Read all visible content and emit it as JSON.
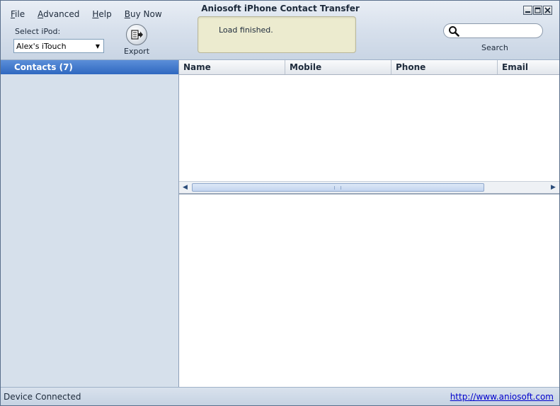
{
  "window": {
    "title": "Aniosoft iPhone Contact Transfer"
  },
  "menu": [
    {
      "label": "File",
      "underline": "F",
      "rest": "ile"
    },
    {
      "label": "Advanced",
      "underline": "A",
      "rest": "dvanced"
    },
    {
      "label": "Help",
      "underline": "H",
      "rest": "elp"
    },
    {
      "label": "Buy Now",
      "underline": "B",
      "rest": "uy Now"
    }
  ],
  "device_select": {
    "label": "Select iPod:",
    "value": "Alex's iTouch"
  },
  "toolbar": {
    "export_label": "Export"
  },
  "status_panel": {
    "message": "Load finished."
  },
  "search": {
    "label": "Search",
    "value": ""
  },
  "sidebar": {
    "header": "Contacts (7)"
  },
  "table": {
    "columns": [
      "Name",
      "Mobile",
      "Phone",
      "Email"
    ]
  },
  "statusbar": {
    "left": "Device Connected",
    "right": "http://www.aniosoft.com"
  },
  "icons": [
    "export-icon",
    "search-icon",
    "minimize-icon",
    "maximize-icon",
    "close-icon",
    "dropdown-arrow-icon",
    "scroll-left-icon",
    "scroll-right-icon"
  ]
}
